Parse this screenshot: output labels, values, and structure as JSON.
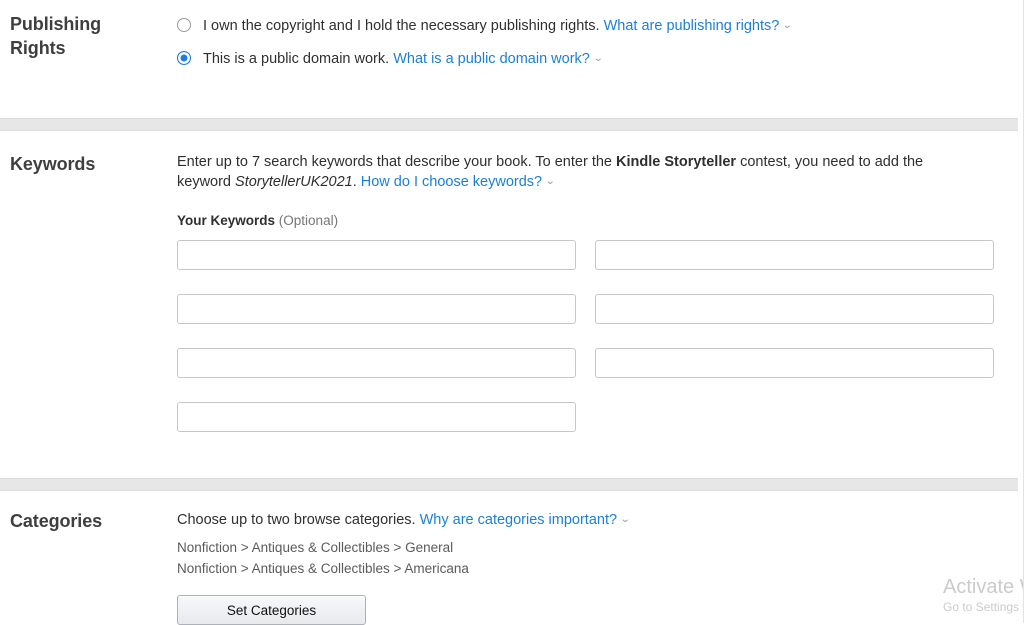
{
  "publishing_rights": {
    "title": "Publishing Rights",
    "options": [
      {
        "text": "I own the copyright and I hold the necessary publishing rights.",
        "link": "What are publishing rights?",
        "selected": false
      },
      {
        "text": "This is a public domain work.",
        "link": "What is a public domain work?",
        "selected": true
      }
    ]
  },
  "keywords": {
    "title": "Keywords",
    "intro_part1": "Enter up to 7 search keywords that describe your book. To enter the ",
    "intro_bold": "Kindle Storyteller",
    "intro_part2": " contest, you need to add the keyword ",
    "intro_italic": "StorytellerUK2021",
    "intro_part3": ". ",
    "intro_link": "How do I choose keywords?",
    "sublabel_strong": "Your Keywords",
    "sublabel_optional": "(Optional)",
    "fields": [
      {
        "value": "",
        "placeholder": ""
      },
      {
        "value": "",
        "placeholder": ""
      },
      {
        "value": "",
        "placeholder": ""
      },
      {
        "value": "",
        "placeholder": ""
      },
      {
        "value": "",
        "placeholder": ""
      },
      {
        "value": "",
        "placeholder": ""
      },
      {
        "value": "",
        "placeholder": ""
      }
    ]
  },
  "categories": {
    "title": "Categories",
    "intro": "Choose up to two browse categories. ",
    "intro_link": "Why are categories important?",
    "selected": [
      "Nonfiction > Antiques & Collectibles > General",
      "Nonfiction > Antiques & Collectibles > Americana"
    ],
    "button_label": "Set Categories"
  },
  "watermark": {
    "title": "Activate Windows",
    "subtitle": "Go to Settings to activate Windows."
  },
  "icons": {
    "chevron_down": "⌄"
  },
  "colors": {
    "link": "#1c7fd6",
    "radio_selected": "#1f7fe0",
    "divider": "#e7e7e7",
    "text": "#2f2f2f"
  }
}
